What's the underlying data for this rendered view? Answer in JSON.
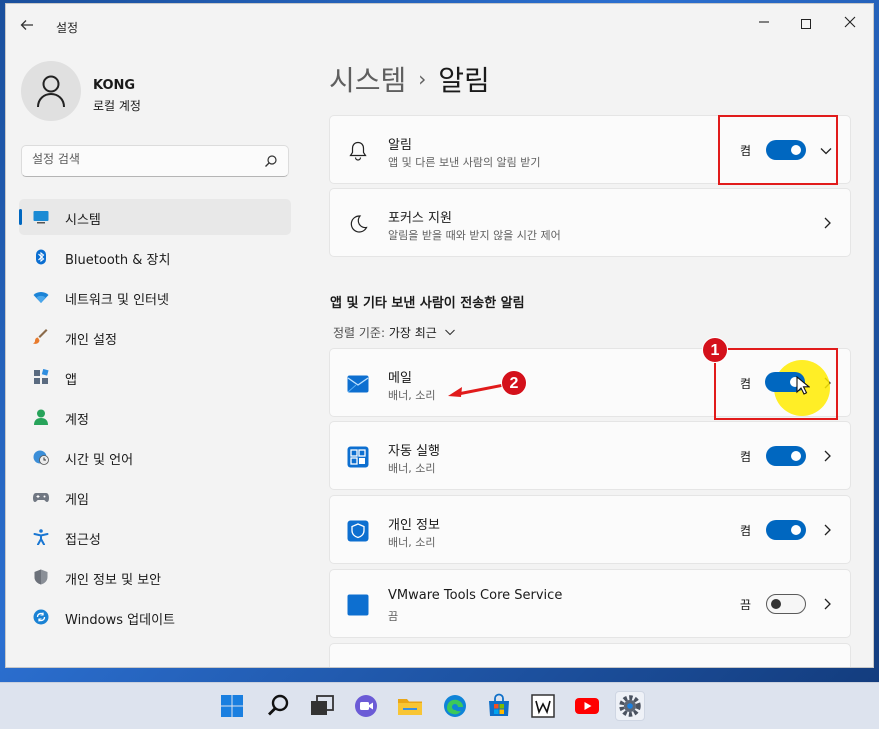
{
  "window": {
    "title": "설정"
  },
  "profile": {
    "name": "KONG",
    "account_type": "로컬 계정"
  },
  "search": {
    "placeholder": "설정 검색"
  },
  "sidebar": {
    "items": [
      {
        "label": "시스템",
        "icon": "monitor-icon",
        "active": true
      },
      {
        "label": "Bluetooth & 장치",
        "icon": "bluetooth-icon"
      },
      {
        "label": "네트워크 및 인터넷",
        "icon": "wifi-icon"
      },
      {
        "label": "개인 설정",
        "icon": "brush-icon"
      },
      {
        "label": "앱",
        "icon": "apps-icon"
      },
      {
        "label": "계정",
        "icon": "person-icon"
      },
      {
        "label": "시간 및 언어",
        "icon": "globe-clock-icon"
      },
      {
        "label": "게임",
        "icon": "gamepad-icon"
      },
      {
        "label": "접근성",
        "icon": "accessibility-icon"
      },
      {
        "label": "개인 정보 및 보안",
        "icon": "shield-icon"
      },
      {
        "label": "Windows 업데이트",
        "icon": "update-icon"
      }
    ]
  },
  "header": {
    "parent": "시스템",
    "separator": "›",
    "current": "알림"
  },
  "cards": {
    "notifications": {
      "title": "알림",
      "subtitle": "앱 및 다른 보낸 사람의 알림 받기",
      "state": "켬",
      "on": true
    },
    "focus": {
      "title": "포커스 지원",
      "subtitle": "알림을 받을 때와 받지 않을 시간 제어"
    }
  },
  "section": {
    "heading": "앱 및 기타 보낸 사람이 전송한 알림",
    "sort_label": "정렬 기준:",
    "sort_value": "가장 최근"
  },
  "apps": [
    {
      "title": "메일",
      "subtitle": "배너, 소리",
      "state": "켬",
      "on": true,
      "icon": "mail-icon"
    },
    {
      "title": "자동 실행",
      "subtitle": "배너, 소리",
      "state": "켬",
      "on": true,
      "icon": "autoplay-icon"
    },
    {
      "title": "개인 정보",
      "subtitle": "배너, 소리",
      "state": "켬",
      "on": true,
      "icon": "security-shield-icon"
    },
    {
      "title": "VMware Tools Core Service",
      "subtitle": "끔",
      "state": "끔",
      "on": false,
      "icon": "vmware-icon"
    }
  ],
  "annotations": {
    "badge_1": "1",
    "badge_2": "2"
  },
  "colors": {
    "accent": "#0067c0",
    "annotation_red": "#e11b1b",
    "highlight_yellow": "#ffeb00"
  },
  "taskbar": {
    "icons": [
      "windows-start-icon",
      "search-icon",
      "task-view-icon",
      "teams-chat-icon",
      "file-explorer-icon",
      "edge-icon",
      "store-icon",
      "wikipedia-icon",
      "youtube-icon",
      "settings-gear-icon"
    ]
  }
}
